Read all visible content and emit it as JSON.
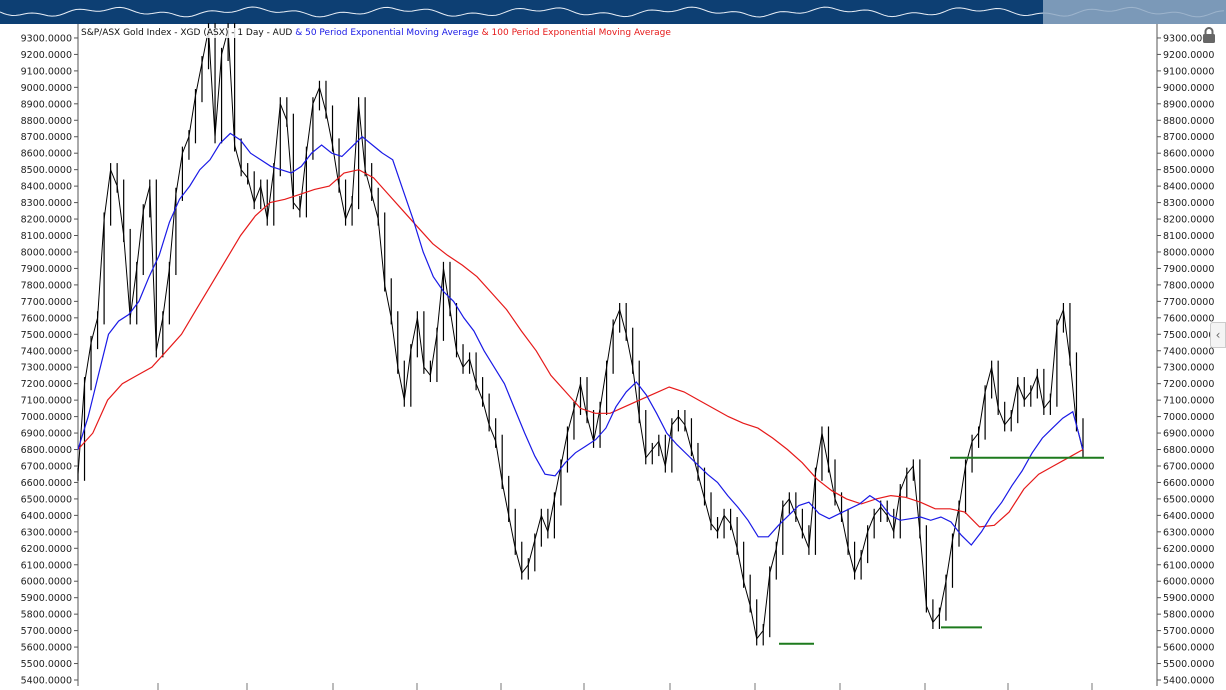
{
  "legend": {
    "base": "S&P/ASX Gold Index - XGD (ASX) - 1 Day - AUD",
    "ema50": "& 50 Period Exponential Moving Average",
    "ema100": "& 100 Period Exponential Moving Average"
  },
  "icons": {
    "lock": "lock-icon",
    "collapse": "chevron-left-icon"
  },
  "colors": {
    "price": "#000000",
    "ema50": "#1a1ae6",
    "ema100": "#e61a1a",
    "support": "#1d7a1d",
    "navigator": "#0d3f73"
  },
  "chart_data": {
    "type": "line",
    "ylim": [
      5400,
      9400
    ],
    "grid": false,
    "y_ticks": [
      "9300.0000",
      "9200.0000",
      "9100.0000",
      "9000.0000",
      "8900.0000",
      "8800.0000",
      "8700.0000",
      "8600.0000",
      "8500.0000",
      "8400.0000",
      "8300.0000",
      "8200.0000",
      "8100.0000",
      "8000.0000",
      "7900.0000",
      "7800.0000",
      "7700.0000",
      "7600.0000",
      "7500.0000",
      "7400.0000",
      "7300.0000",
      "7200.0000",
      "7100.0000",
      "7000.0000",
      "6900.0000",
      "6800.0000",
      "6700.0000",
      "6600.0000",
      "6500.0000",
      "6400.0000",
      "6300.0000",
      "6200.0000",
      "6100.0000",
      "6000.0000",
      "5900.0000",
      "5800.0000",
      "5700.0000",
      "5600.0000",
      "5500.0000",
      "5400.0000"
    ],
    "series": [
      {
        "name": "S&P/ASX Gold Index - XGD (ASX) - 1 Day - AUD",
        "values": [
          6650,
          7200,
          7450,
          7600,
          8200,
          8500,
          8400,
          8100,
          7600,
          7900,
          8250,
          8400,
          7400,
          7600,
          7900,
          8350,
          8600,
          8700,
          8950,
          9150,
          9350,
          8700,
          9200,
          9350,
          8650,
          8500,
          8450,
          8300,
          8400,
          8200,
          8500,
          8900,
          8800,
          8300,
          8250,
          8600,
          8900,
          9000,
          8850,
          8650,
          8400,
          8200,
          8300,
          8900,
          8500,
          8350,
          8200,
          7800,
          7600,
          7300,
          7100,
          7400,
          7600,
          7300,
          7250,
          7500,
          7900,
          7650,
          7400,
          7300,
          7350,
          7200,
          7100,
          6950,
          6850,
          6600,
          6400,
          6200,
          6050,
          6100,
          6250,
          6400,
          6300,
          6500,
          6700,
          6900,
          7050,
          7200,
          7000,
          6850,
          7050,
          7300,
          7550,
          7650,
          7500,
          7300,
          7000,
          6750,
          6800,
          6850,
          6700,
          6950,
          7000,
          6950,
          6800,
          6650,
          6500,
          6350,
          6300,
          6400,
          6350,
          6200,
          6000,
          5850,
          5650,
          5700,
          6050,
          6200,
          6450,
          6500,
          6400,
          6300,
          6200,
          6650,
          6900,
          6700,
          6500,
          6400,
          6200,
          6050,
          6150,
          6300,
          6400,
          6450,
          6400,
          6300,
          6550,
          6650,
          6700,
          6300,
          5850,
          5750,
          5800,
          6000,
          6250,
          6450,
          6700,
          6850,
          6900,
          7150,
          7300,
          7050,
          6950,
          7000,
          7200,
          7100,
          7150,
          7250,
          7050,
          7100,
          7550,
          7650,
          7350,
          6950,
          6790
        ]
      },
      {
        "name": "50 Period Exponential Moving Average",
        "values": [
          6800,
          7000,
          7250,
          7500,
          7580,
          7620,
          7700,
          7850,
          7980,
          8180,
          8320,
          8400,
          8500,
          8560,
          8660,
          8720,
          8680,
          8600,
          8560,
          8520,
          8500,
          8480,
          8520,
          8600,
          8650,
          8600,
          8580,
          8640,
          8700,
          8650,
          8600,
          8560,
          8380,
          8200,
          8000,
          7850,
          7760,
          7700,
          7600,
          7520,
          7400,
          7300,
          7200,
          7050,
          6900,
          6760,
          6650,
          6640,
          6720,
          6780,
          6820,
          6860,
          6930,
          7060,
          7150,
          7210,
          7130,
          7020,
          6900,
          6830,
          6770,
          6710,
          6650,
          6600,
          6520,
          6450,
          6370,
          6270,
          6270,
          6340,
          6400,
          6460,
          6480,
          6410,
          6380,
          6410,
          6440,
          6470,
          6520,
          6480,
          6400,
          6370,
          6380,
          6390,
          6370,
          6390,
          6360,
          6280,
          6220,
          6300,
          6400,
          6480,
          6580,
          6670,
          6780,
          6870,
          6930,
          6990,
          7030,
          6800
        ]
      },
      {
        "name": "100 Period Exponential Moving Average",
        "values": [
          6800,
          6900,
          7100,
          7200,
          7250,
          7300,
          7400,
          7500,
          7650,
          7800,
          7950,
          8100,
          8220,
          8300,
          8320,
          8350,
          8380,
          8400,
          8480,
          8500,
          8450,
          8350,
          8250,
          8150,
          8050,
          7980,
          7920,
          7850,
          7750,
          7650,
          7520,
          7400,
          7250,
          7150,
          7050,
          7020,
          7020,
          7060,
          7100,
          7140,
          7180,
          7150,
          7100,
          7050,
          7000,
          6960,
          6930,
          6870,
          6800,
          6720,
          6620,
          6550,
          6500,
          6470,
          6500,
          6520,
          6510,
          6480,
          6440,
          6440,
          6420,
          6330,
          6340,
          6420,
          6560,
          6650,
          6700,
          6750,
          6800
        ]
      },
      {
        "name": "Support Line 6750",
        "values": [
          6750,
          6750
        ]
      },
      {
        "name": "Low Marker 5620",
        "values": [
          5620,
          5620
        ]
      },
      {
        "name": "Low Marker 5720",
        "values": [
          5720,
          5720
        ]
      }
    ]
  }
}
